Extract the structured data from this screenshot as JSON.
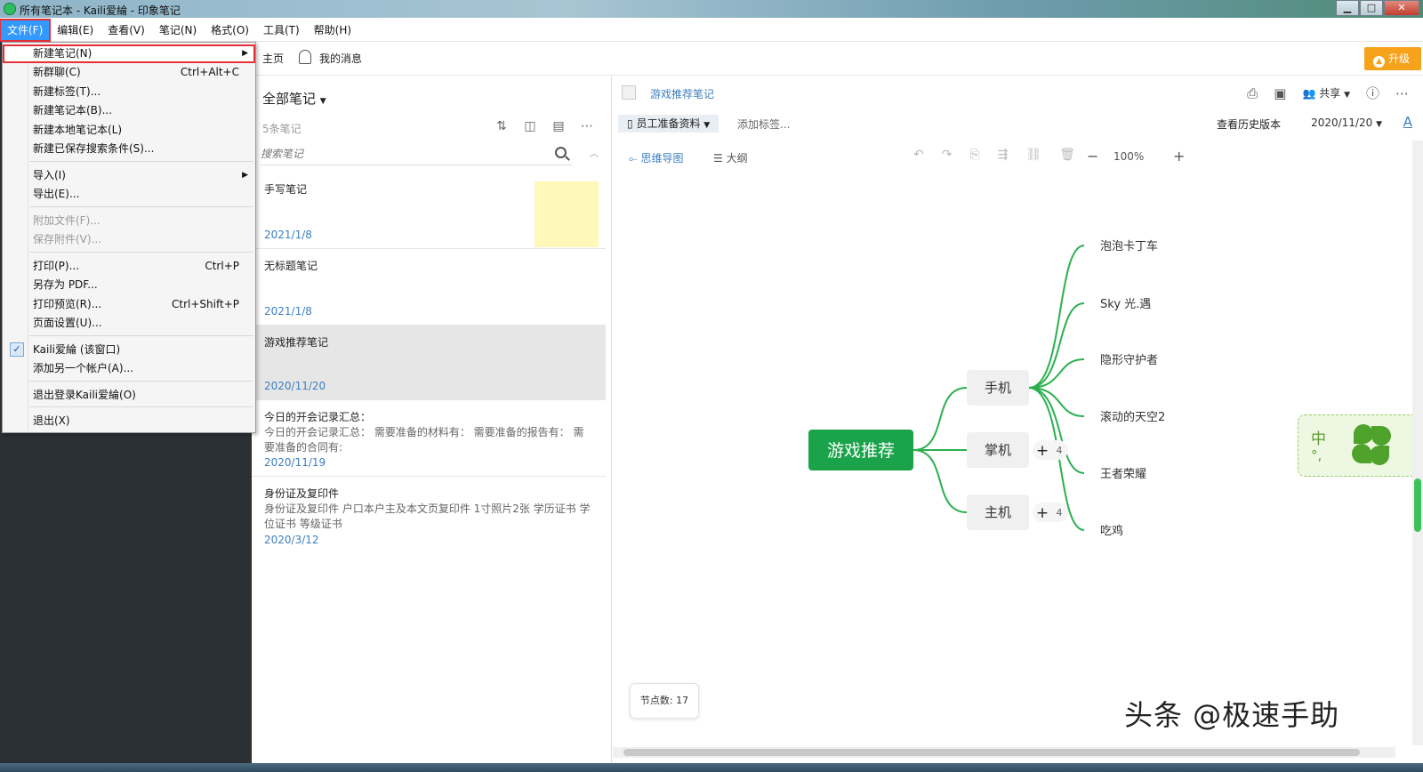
{
  "window": {
    "title": "所有笔记本 - Kaili爱綸 - 印象笔记",
    "min": "▁",
    "max": "□",
    "close": "✕"
  },
  "menubar": [
    "文件(F)",
    "编辑(E)",
    "查看(V)",
    "笔记(N)",
    "格式(O)",
    "工具(T)",
    "帮助(H)"
  ],
  "topstrip": {
    "home": "主页",
    "messages": "我的消息",
    "upgrade": "升级"
  },
  "notelist": {
    "header": "全部笔记",
    "count": "5条笔记",
    "search_placeholder": "搜索笔记",
    "notes": [
      {
        "title": "手写笔记",
        "snippet": "",
        "date": "2021/1/8",
        "thumb": true
      },
      {
        "title": "无标题笔记",
        "snippet": "",
        "date": "2021/1/8"
      },
      {
        "title": "游戏推荐笔记",
        "snippet": "",
        "date": "2020/11/20",
        "selected": true
      },
      {
        "title": "今日的开会记录汇总：",
        "snippet": "今日的开会记录汇总： 需要准备的材料有： 需要准备的报告有： 需要准备的合同有:",
        "date": "2020/11/19"
      },
      {
        "title": "身份证及复印件",
        "snippet": "身份证及复印件 户口本户主及本文页复印件 1寸照片2张 学历证书 学位证书 等级证书",
        "date": "2020/3/12"
      }
    ]
  },
  "editor": {
    "note_title": "游戏推荐笔记",
    "share": "共享",
    "notebook": "员工准备资料",
    "add_tag": "添加标签...",
    "history": "查看历史版本",
    "date": "2020/11/20",
    "font_button": "A",
    "mindmap_tab": "思维导图",
    "outline_tab": "大纲",
    "zoom": "100%",
    "node_count": "节点数: 17",
    "widget_zh": "中",
    "widget_dot": "°,",
    "watermark": "头条 @极速手助"
  },
  "mindmap": {
    "root": "游戏推荐",
    "branches": [
      {
        "label": "手机",
        "count": ""
      },
      {
        "label": "掌机",
        "count": "4"
      },
      {
        "label": "主机",
        "count": "4"
      }
    ],
    "leaves": [
      "泡泡卡丁车",
      "Sky 光.遇",
      "隐形守护者",
      "滚动的天空2",
      "王者荣耀",
      "吃鸡"
    ],
    "colors": {
      "root": "#1aa34a",
      "line": "#2bb04f",
      "branch_bg": "#f0f0f0"
    }
  },
  "filemenu": {
    "items": [
      {
        "label": "新建笔记(N)",
        "shortcut": "",
        "submenu": true,
        "highlight": true
      },
      {
        "label": "新群聊(C)",
        "shortcut": "Ctrl+Alt+C"
      },
      {
        "label": "新建标签(T)..."
      },
      {
        "label": "新建笔记本(B)..."
      },
      {
        "label": "新建本地笔记本(L)"
      },
      {
        "label": "新建已保存搜索条件(S)..."
      },
      {
        "label": "导入(I)",
        "submenu": true
      },
      {
        "label": "导出(E)..."
      },
      {
        "label": "附加文件(F)...",
        "disabled": true
      },
      {
        "label": "保存附件(V)...",
        "disabled": true
      },
      {
        "label": "打印(P)...",
        "shortcut": "Ctrl+P"
      },
      {
        "label": "另存为 PDF..."
      },
      {
        "label": "打印预览(R)...",
        "shortcut": "Ctrl+Shift+P"
      },
      {
        "label": "页面设置(U)..."
      },
      {
        "label": "Kaili爱綸 (该窗口)",
        "checked": true
      },
      {
        "label": "添加另一个帐户(A)..."
      },
      {
        "label": "退出登录Kaili爱綸(O)"
      },
      {
        "label": "退出(X)"
      }
    ]
  }
}
